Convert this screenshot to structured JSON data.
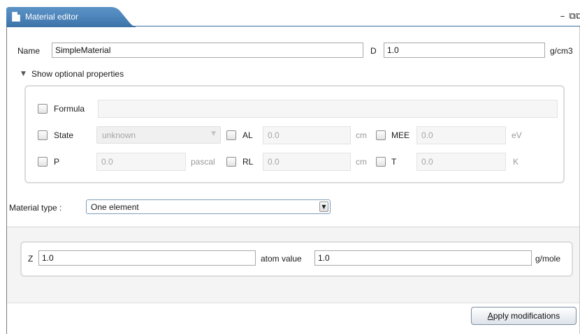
{
  "window": {
    "title": "Material editor",
    "minimize_glyph": "–",
    "maximize_glyph": "⧉",
    "extra_glyph": "⧉"
  },
  "colors": {
    "tab_blue": "#4f86bb",
    "tab_dark": "#2e5f92",
    "frame": "#7d7d7d"
  },
  "main": {
    "name_label": "Name",
    "name_value": "SimpleMaterial",
    "density_label": "D",
    "density_value": "1.0",
    "density_unit": "g/cm3",
    "optional_toggle_icon": "triangle-down",
    "optional_toggle_glyph": "▼",
    "optional_toggle_label": "Show optional properties"
  },
  "optional": {
    "formula_label": "Formula",
    "formula_value": "",
    "state_label": "State",
    "state_value": "unknown",
    "state_arrow": "▼",
    "al_label": "AL",
    "al_value": "0.0",
    "al_unit": "cm",
    "mee_label": "MEE",
    "mee_value": "0.0",
    "mee_unit": "eV",
    "p_label": "P",
    "p_value": "0.0",
    "p_unit": "pascal",
    "rl_label": "RL",
    "rl_value": "0.0",
    "rl_unit": "cm",
    "t_label": "T",
    "t_value": "0.0",
    "t_unit": "K"
  },
  "material_type": {
    "label": "Material type :",
    "value": "One element",
    "arrow": "▼"
  },
  "element": {
    "z_label": "Z",
    "z_value": "1.0",
    "atom_label": "atom value",
    "atom_value": "1.0",
    "atom_unit": "g/mole"
  },
  "footer": {
    "apply_mnemonic": "A",
    "apply_rest": "pply modifications"
  }
}
